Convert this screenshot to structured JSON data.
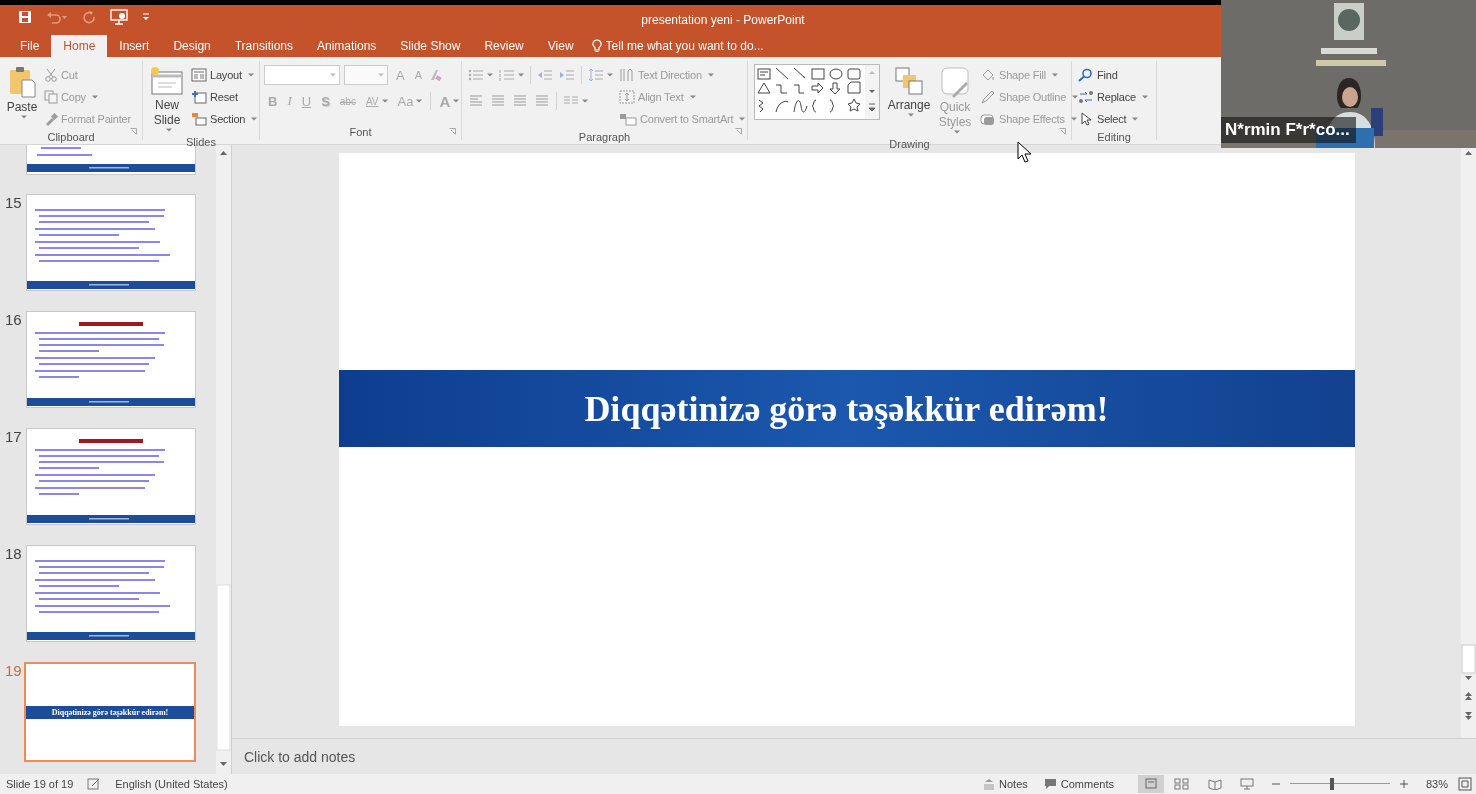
{
  "window": {
    "title": "presentation yeni - PowerPoint"
  },
  "tabs": [
    {
      "label": "File",
      "selected": false
    },
    {
      "label": "Home",
      "selected": true
    },
    {
      "label": "Insert",
      "selected": false
    },
    {
      "label": "Design",
      "selected": false
    },
    {
      "label": "Transitions",
      "selected": false
    },
    {
      "label": "Animations",
      "selected": false
    },
    {
      "label": "Slide Show",
      "selected": false
    },
    {
      "label": "Review",
      "selected": false
    },
    {
      "label": "View",
      "selected": false
    }
  ],
  "tell_me": {
    "placeholder": "Tell me what you want to do..."
  },
  "ribbon": [
    {
      "kind": "clipboard",
      "label": "Clipboard",
      "items": [
        {
          "label": "Paste",
          "disabled": false
        },
        {
          "label": "Cut",
          "disabled": true
        },
        {
          "label": "Copy",
          "disabled": true
        },
        {
          "label": "Format Painter",
          "disabled": true
        }
      ]
    },
    {
      "kind": "slides",
      "label": "Slides",
      "items": [
        {
          "label": "New Slide",
          "disabled": false
        },
        {
          "label": "Layout",
          "disabled": false
        },
        {
          "label": "Reset",
          "disabled": false
        },
        {
          "label": "Section",
          "disabled": false
        }
      ]
    },
    {
      "kind": "font",
      "label": "Font",
      "items": [
        {
          "label": "A",
          "disabled": true
        },
        {
          "label": "A",
          "disabled": true
        },
        {
          "label": "B",
          "disabled": true
        },
        {
          "label": "I",
          "disabled": true
        },
        {
          "label": "U",
          "disabled": true
        },
        {
          "label": "S",
          "disabled": true
        },
        {
          "label": "abc",
          "disabled": true
        },
        {
          "label": "AV",
          "disabled": true
        },
        {
          "label": "Aa",
          "disabled": true
        },
        {
          "label": "A",
          "disabled": true
        }
      ]
    },
    {
      "kind": "paragraph",
      "label": "Paragraph",
      "items": [
        {
          "label": "Text Direction",
          "disabled": true
        },
        {
          "label": "Align Text",
          "disabled": true
        },
        {
          "label": "Convert to SmartArt",
          "disabled": true
        }
      ]
    },
    {
      "kind": "drawing",
      "label": "Drawing",
      "items": [
        {
          "label": "Arrange",
          "disabled": false
        },
        {
          "label": "Quick Styles",
          "disabled": true
        },
        {
          "label": "Shape Fill",
          "disabled": true
        },
        {
          "label": "Shape Outline",
          "disabled": true
        },
        {
          "label": "Shape Effects",
          "disabled": true
        }
      ]
    },
    {
      "kind": "editing",
      "label": "Editing",
      "items": [
        {
          "label": "Find",
          "disabled": false
        },
        {
          "label": "Replace",
          "disabled": false
        },
        {
          "label": "Select",
          "disabled": false
        }
      ]
    }
  ],
  "slides": [
    {
      "kind": "partial",
      "selected": false
    },
    {
      "kind": "bullets",
      "number": "15",
      "selected": false
    },
    {
      "kind": "titled",
      "number": "16",
      "selected": false
    },
    {
      "kind": "titled",
      "number": "17",
      "selected": false
    },
    {
      "kind": "bullets",
      "number": "18",
      "selected": false
    },
    {
      "kind": "closing",
      "number": "19",
      "selected": true,
      "title": "Diqqətinizə görə təşəkkür edirəm!"
    }
  ],
  "slide": {
    "banner": "Diqqətinizə görə təşəkkür edirəm!"
  },
  "notes": {
    "placeholder": "Click to add notes"
  },
  "status_bar": {
    "slide": "Slide 19 of 19",
    "language": "English (United States)",
    "notes": "Notes",
    "comments": "Comments",
    "zoom": "83%",
    "zoom_slider": {
      "level": 0.42
    }
  },
  "video": {
    "participant": "N*rmin F*r*co..."
  }
}
